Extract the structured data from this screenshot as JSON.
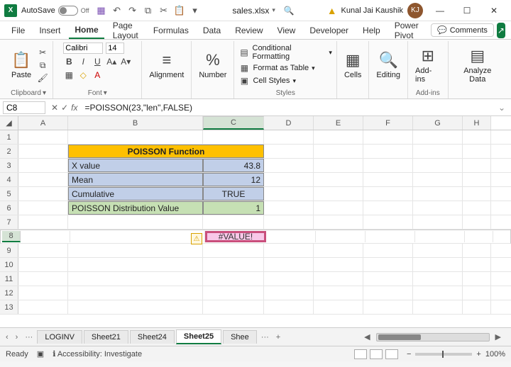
{
  "title": {
    "autosave": "AutoSave",
    "autosave_state": "Off",
    "filename": "sales.xlsx",
    "user": "Kunal Jai Kaushik",
    "initials": "KJ"
  },
  "tabs": {
    "file": "File",
    "insert": "Insert",
    "home": "Home",
    "page": "Page Layout",
    "formulas": "Formulas",
    "data": "Data",
    "review": "Review",
    "view": "View",
    "developer": "Developer",
    "help": "Help",
    "power": "Power Pivot",
    "comments": "Comments"
  },
  "ribbon": {
    "clipboard": "Clipboard",
    "paste": "Paste",
    "font": "Font",
    "font_name": "Calibri",
    "font_size": "14",
    "alignment": "Alignment",
    "number": "Number",
    "styles": "Styles",
    "cond_fmt": "Conditional Formatting",
    "fmt_table": "Format as Table",
    "cell_styles": "Cell Styles",
    "cells": "Cells",
    "editing": "Editing",
    "addins": "Add-ins",
    "addins_group": "Add-ins",
    "analyze": "Analyze Data"
  },
  "fbar": {
    "cell_ref": "C8",
    "formula": "=POISSON(23,\"len\",FALSE)"
  },
  "cols": [
    "A",
    "B",
    "C",
    "D",
    "E",
    "F",
    "G",
    "H"
  ],
  "rows": [
    "1",
    "2",
    "3",
    "4",
    "5",
    "6",
    "7",
    "8",
    "9",
    "10",
    "11",
    "12",
    "13"
  ],
  "cells": {
    "title": "POISSON Function",
    "b3": "X value",
    "c3": "43.8",
    "b4": "Mean",
    "c4": "12",
    "b5": "Cumulative",
    "c5": "TRUE",
    "b6": "POISSON Distribution Value",
    "c6": "1",
    "c8": "#VALUE!"
  },
  "sheets": {
    "nav_prev": "‹",
    "nav_next": "›",
    "more": "···",
    "t1": "LOGINV",
    "t2": "Sheet21",
    "t3": "Sheet24",
    "t4": "Sheet25",
    "t5": "Shee",
    "more2": "···",
    "add": "+"
  },
  "status": {
    "ready": "Ready",
    "access": "Accessibility: Investigate",
    "zoom": "100%"
  }
}
